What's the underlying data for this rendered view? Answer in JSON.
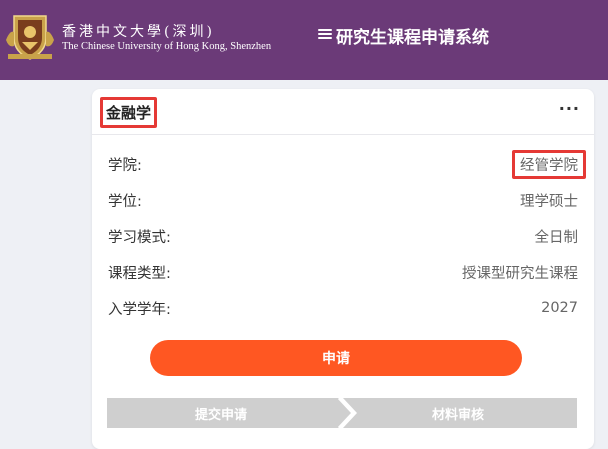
{
  "header": {
    "university_cn": "香港中文大學(深圳)",
    "university_en": "The Chinese University of Hong Kong, Shenzhen",
    "system_title": "研究生课程申请系统",
    "menu_icon": "hamburger-menu-icon",
    "brand_color": "#6b3a78"
  },
  "program": {
    "title": "金融学",
    "more_label": "···",
    "fields": [
      {
        "label": "学院:",
        "value": "经管学院"
      },
      {
        "label": "学位:",
        "value": "理学硕士"
      },
      {
        "label": "学习模式:",
        "value": "全日制"
      },
      {
        "label": "课程类型:",
        "value": "授课型研究生课程"
      },
      {
        "label": "入学学年:",
        "value": "2027"
      }
    ],
    "apply_label": "申请",
    "apply_color": "#ff5722"
  },
  "steps": [
    {
      "label": "提交申请"
    },
    {
      "label": "材料审核"
    }
  ]
}
